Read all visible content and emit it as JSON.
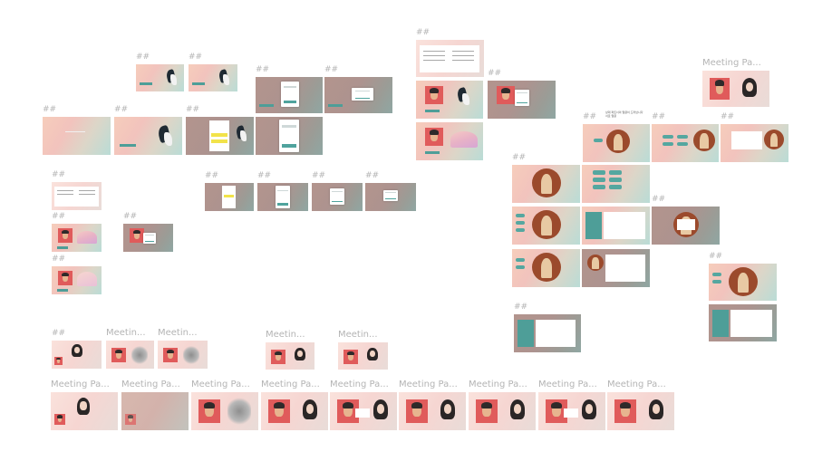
{
  "canvas": {
    "background": "#ffffff"
  },
  "labels": {
    "hash": "##",
    "meeting_page": "Meeting Pa...",
    "meetin_a": "Meetin...",
    "meetin_b": "Meetin..."
  },
  "small_text": {
    "heading_text": "상대 파트너의 얼굴이 드러납니다 서로 얼굴"
  },
  "colors": {
    "accent_teal": "#4e9e98",
    "face_red": "#e05b5b",
    "label_gray": "#b4b4b4",
    "highlight_yellow": "#f2e34a"
  },
  "icons": [
    "avatar-illustration",
    "plant-illustration",
    "blurred-avatar"
  ]
}
